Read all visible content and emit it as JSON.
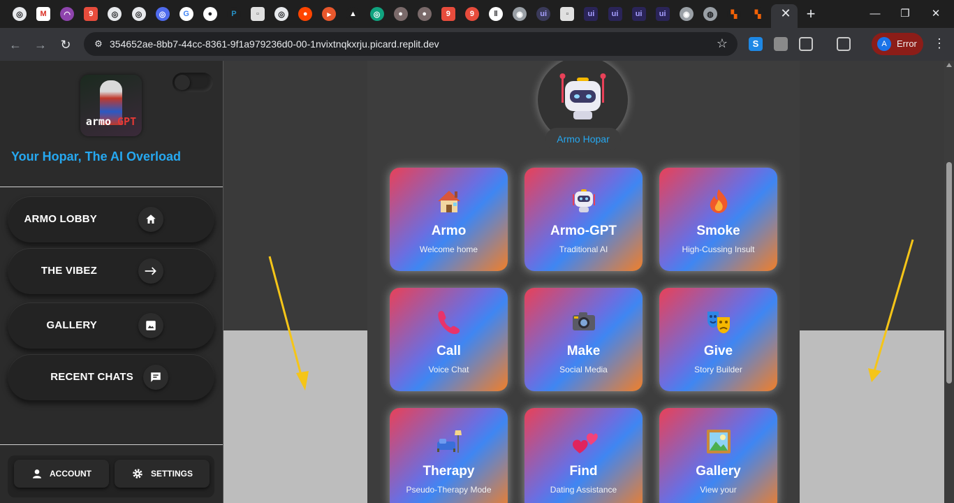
{
  "browser": {
    "tab_close": "✕",
    "new_tab": "+",
    "url": "354652ae-8bb7-44cc-8361-9f1a979236d0-00-1nvixtnqkxrju.picard.replit.dev",
    "profile_initial": "A",
    "profile_label": "Error",
    "tab_favicons": [
      "openai",
      "gmail",
      "rainbow",
      "nine",
      "openai",
      "openai",
      "openai-blue",
      "google",
      "github",
      "paypal",
      "doc",
      "openai",
      "reddit",
      "play",
      "vercel",
      "openai-green",
      "avatar",
      "avatar",
      "nine",
      "nine-circle",
      "pause",
      "chrome",
      "ui-circle",
      "doc",
      "ui",
      "ui",
      "ui",
      "ui",
      "chrome",
      "globe",
      "replit",
      "replit"
    ]
  },
  "sidebar": {
    "logo_text_main": "armo",
    "logo_text_accent": "GPT",
    "tagline": "Your Hopar, The AI Overload",
    "nav": [
      {
        "label": "ARMO LOBBY",
        "icon": "home-icon"
      },
      {
        "label": "THE VIBEZ",
        "icon": "arrow-right-icon"
      },
      {
        "label": "GALLERY",
        "icon": "image-icon"
      },
      {
        "label": "RECENT CHATS",
        "icon": "chat-icon"
      }
    ],
    "account_label": "ACCOUNT",
    "settings_label": "SETTINGS"
  },
  "main": {
    "bot_name": "Armo Hopar",
    "cards": [
      {
        "title": "Armo",
        "subtitle": "Welcome home",
        "icon": "house-icon"
      },
      {
        "title": "Armo-GPT",
        "subtitle": "Traditional AI",
        "icon": "robot-icon"
      },
      {
        "title": "Smoke",
        "subtitle": "High-Cussing Insult",
        "icon": "fire-icon"
      },
      {
        "title": "Call",
        "subtitle": "Voice Chat",
        "icon": "phone-icon"
      },
      {
        "title": "Make",
        "subtitle": "Social Media",
        "icon": "camera-icon"
      },
      {
        "title": "Give",
        "subtitle": "Story Builder",
        "icon": "theater-masks-icon"
      },
      {
        "title": "Therapy",
        "subtitle": "Pseudo-Therapy Mode",
        "icon": "couch-lamp-icon"
      },
      {
        "title": "Find",
        "subtitle": "Dating Assistance",
        "icon": "hearts-icon"
      },
      {
        "title": "Gallery",
        "subtitle": "View your",
        "icon": "framed-picture-icon"
      }
    ]
  },
  "colors": {
    "accent_blue": "#26a8f0",
    "annotation_arrow": "#f5c518",
    "card_gradient": [
      "#e84158",
      "#3f86f2",
      "#f07f2a"
    ]
  }
}
